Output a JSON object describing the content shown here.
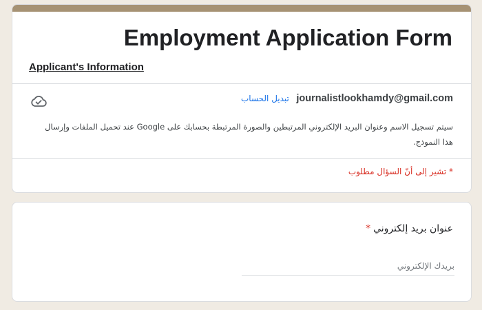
{
  "form": {
    "title": "Employment Application Form",
    "section_heading": "Applicant's Information",
    "account_email": "journalistlookhamdy@gmail.com",
    "switch_account_label": "تبديل الحساب",
    "cloud_icon": "cloud-done-icon",
    "notice": "سيتم تسجيل الاسم وعنوان البريد الإلكتروني المرتبطين والصورة المرتبطة بحسابك على Google عند تحميل الملفات وإرسال هذا النموذج.",
    "required_note": "* تشير إلى أنّ السؤال مطلوب"
  },
  "question": {
    "label": "عنوان بريد إلكتروني",
    "required_mark": "*",
    "placeholder": "بريدك الإلكتروني",
    "value": ""
  },
  "colors": {
    "accent_bar": "#a69274",
    "background": "#f0ebe3",
    "link": "#1a73e8",
    "required": "#d93025"
  }
}
